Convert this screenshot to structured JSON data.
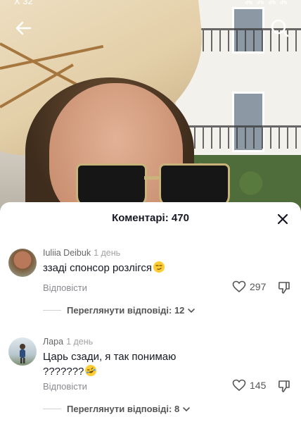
{
  "status": {
    "time": "Х 32",
    "indicators": "⌘ ⌘ ⌘ ⌘"
  },
  "top_bar": {
    "back_icon": "arrow-left-icon",
    "search_icon": "search-icon"
  },
  "sheet": {
    "title": "Коментарі: 470",
    "close_icon": "close-icon"
  },
  "comments": [
    {
      "author": "Iuliia Deibuk",
      "date": "1 день",
      "text": "ззаді спонсор розлігся",
      "emoji": "smirk",
      "reply_label": "Відповісти",
      "likes": "297",
      "view_replies": "Переглянути відповіді: 12"
    },
    {
      "author": "Лара",
      "date": "1 день",
      "text_line1": "Царь сзади, я так понимаю",
      "text_line2": "???????",
      "emoji": "rofl",
      "reply_label": "Відповісти",
      "likes": "145",
      "view_replies": "Переглянути відповіді: 8"
    }
  ],
  "colors": {
    "accent": "#161823",
    "muted": "#8a8b91",
    "emoji": "#ffcc33"
  }
}
